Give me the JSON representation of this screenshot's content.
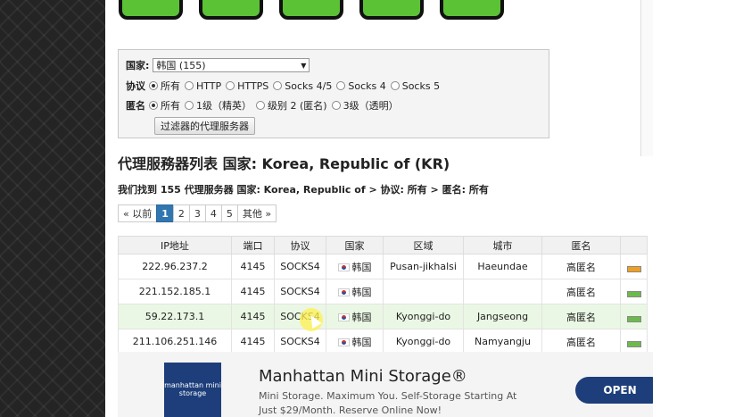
{
  "filter": {
    "country_label": "国家:",
    "country_value": "韩国 (155)",
    "protocol_label": "协议",
    "protocol_options": [
      "所有",
      "HTTP",
      "HTTPS",
      "Socks 4/5",
      "Socks 4",
      "Socks 5"
    ],
    "protocol_selected": 0,
    "anonymity_label": "匿名",
    "anonymity_options": [
      "所有",
      "1级（精英）",
      "级别 2 (匿名)",
      "3级（透明）"
    ],
    "anonymity_selected": 0,
    "button_label": "过滤器的代理服务器"
  },
  "page_title": "代理服務器列表 国家: Korea, Republic of (KR)",
  "result_line": "我们找到 155 代理服务器 国家: Korea, Republic of > 协议: 所有 > 匿名: 所有",
  "pagination": [
    "« 以前",
    "1",
    "2",
    "3",
    "4",
    "5",
    "其他 »"
  ],
  "pagination_active": 1,
  "table": {
    "headers": [
      "IP地址",
      "端口",
      "协议",
      "国家",
      "区域",
      "城市",
      "匿名"
    ],
    "rows": [
      {
        "ip": "222.96.237.2",
        "port": "4145",
        "protocol": "SOCKS4",
        "country": "韩国",
        "region": "Pusan-jikhalsi",
        "city": "Haeundae",
        "anon": "高匿名",
        "speed_color": "#f0a020"
      },
      {
        "ip": "221.152.185.1",
        "port": "4145",
        "protocol": "SOCKS4",
        "country": "韩国",
        "region": "",
        "city": "",
        "anon": "高匿名",
        "speed_color": "#6cbb4a"
      },
      {
        "ip": "59.22.173.1",
        "port": "4145",
        "protocol": "SOCKS4",
        "country": "韩国",
        "region": "Kyonggi-do",
        "city": "Jangseong",
        "anon": "高匿名",
        "speed_color": "#6cbb4a"
      },
      {
        "ip": "211.106.251.146",
        "port": "4145",
        "protocol": "SOCKS4",
        "country": "韩国",
        "region": "Kyonggi-do",
        "city": "Namyangju",
        "anon": "高匿名",
        "speed_color": "#6cbb4a"
      }
    ]
  },
  "ad": {
    "logo": "manhattan mini storage",
    "title": "Manhattan Mini Storage®",
    "desc": "Mini Storage. Maximum You. Self-Storage Starting At Just $29/Month. Reserve Online Now!",
    "button": "OPEN"
  }
}
